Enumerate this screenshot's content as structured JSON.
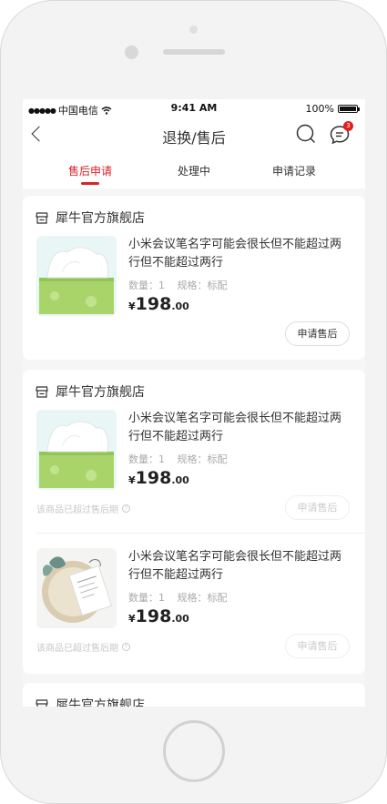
{
  "status_bar": {
    "carrier": "中国电信",
    "time": "9:41 AM",
    "battery": "100%",
    "battery_level": 1.0
  },
  "nav": {
    "title": "退换/售后",
    "badge_count": "3"
  },
  "tabs": [
    {
      "label": "售后申请",
      "active": true
    },
    {
      "label": "处理中",
      "active": false
    },
    {
      "label": "申请记录",
      "active": false
    }
  ],
  "orders": [
    {
      "shop_name": "犀牛官方旗舰店",
      "items": [
        {
          "title": "小米会议笔名字可能会很长但不能超过两行但不能超过两行",
          "quantity_label": "数量：1",
          "spec_label": "规格：标配",
          "currency": "¥",
          "price_int": "198",
          "price_dec": ".00",
          "button_label": "申请售后",
          "thumbnail": "tissue-box-image"
        }
      ]
    },
    {
      "shop_name": "犀牛官方旗舰店",
      "items": [
        {
          "title": "小米会议笔名字可能会很长但不能超过两行但不能超过两行",
          "quantity_label": "数量：1",
          "spec_label": "规格：标配",
          "currency": "¥",
          "price_int": "198",
          "price_dec": ".00",
          "expired_note": "该商品已超过售后期",
          "button_label": "申请售后",
          "thumbnail": "tissue-box-image"
        },
        {
          "title": "小米会议笔名字可能会很长但不能超过两行但不能超过两行",
          "quantity_label": "数量：1",
          "spec_label": "规格：标配",
          "currency": "¥",
          "price_int": "198",
          "price_dec": ".00",
          "expired_note": "该商品已超过售后期",
          "button_label": "申请售后",
          "thumbnail": "gift-card-image"
        }
      ]
    },
    {
      "shop_name": "犀牛官方旗舰店",
      "items": []
    }
  ],
  "colors": {
    "accent": "#d8232a",
    "background": "#f6f6f6"
  }
}
